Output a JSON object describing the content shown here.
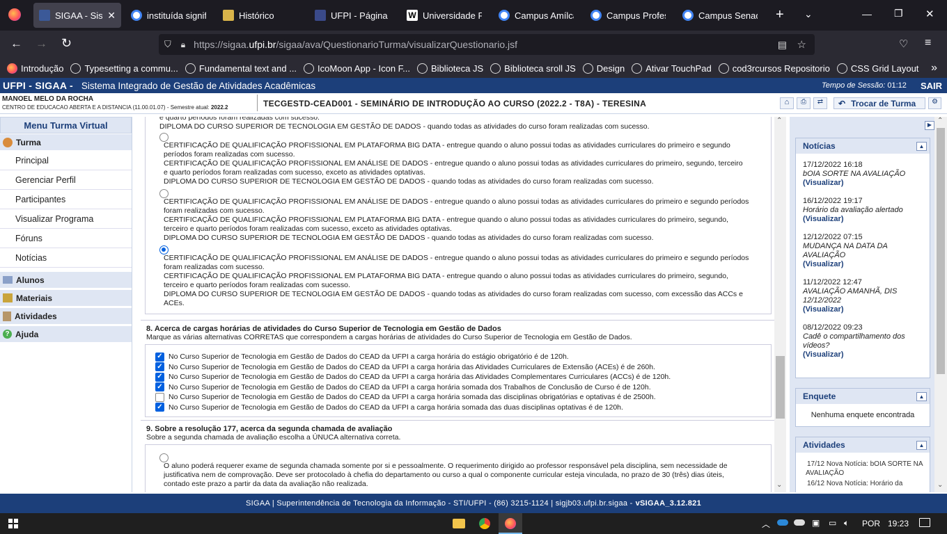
{
  "browser": {
    "tabs": [
      {
        "title": "SIGAA - Sistema",
        "active": true
      },
      {
        "title": "instituída signific"
      },
      {
        "title": "Histórico"
      },
      {
        "title": "UFPI - Página ini"
      },
      {
        "title": "Universidade Fed"
      },
      {
        "title": "Campus Amílcar"
      },
      {
        "title": "Campus Professo"
      },
      {
        "title": "Campus Senador"
      }
    ],
    "url_prefix": "https://sigaa.",
    "url_domain": "ufpi.br",
    "url_path": "/sigaa/ava/QuestionarioTurma/visualizarQuestionario.jsf",
    "bookmarks": [
      "Introdução",
      "Typesetting a commu...",
      "Fundamental text and ...",
      "IcoMoon App - Icon F...",
      "Biblioteca JS",
      "Biblioteca sroll JS",
      "Design",
      "Ativar TouchPad",
      "cod3rcursos Repositorio",
      "CSS Grid Layout"
    ]
  },
  "header": {
    "brand": "UFPI - SIGAA -",
    "system_name": "Sistema Integrado de Gestão de Atividades Acadêmicas",
    "session_label": "Tempo de Sessão:",
    "session_time": "01:12",
    "exit": "SAIR"
  },
  "user": {
    "name": "MANOEL MELO DA ROCHA",
    "center": "CENTRO DE EDUCACAO ABERTA E A DISTANCIA (11.00.01.07) - Semestre atual:",
    "semester": "2022.2"
  },
  "course_title": "TECGESTD-CEAD001 - SEMINÁRIO DE INTRODUÇÃO AO CURSO (2022.2 - T8A) - TERESINA",
  "switch_class": "Trocar de Turma",
  "menu": {
    "title": "Menu Turma Virtual",
    "turma": "Turma",
    "items": [
      "Principal",
      "Gerenciar Perfil",
      "Participantes",
      "Visualizar Programa",
      "Fóruns",
      "Notícias"
    ],
    "sections": [
      "Alunos",
      "Materiais",
      "Atividades",
      "Ajuda"
    ]
  },
  "q7": {
    "top_lines": [
      "e quarto períodos foram realizadas com sucesso.",
      "DIPLOMA DO CURSO SUPERIOR DE TECNOLOGIA EM GESTÃO DE DADOS - quando todas as atividades do curso foram realizadas com sucesso."
    ],
    "options": [
      {
        "selected": false,
        "lines": [
          "CERTIFICAÇÃO DE QUALIFICAÇÃO PROFISSIONAL EM PLATAFORMA BIG DATA - entregue quando o aluno possui todas as atividades curriculares do primeiro e segundo",
          "períodos foram realizadas com sucesso.",
          "CERTIFICAÇÃO DE QUALIFICAÇÃO PROFISSIONAL EM ANÁLISE DE DADOS  - entregue quando o aluno possui todas as atividades curriculares do primeiro, segundo, terceiro",
          "e quarto períodos foram realizadas com sucesso, exceto as atividades optativas.",
          "DIPLOMA DO CURSO SUPERIOR DE TECNOLOGIA EM GESTÃO DE DADOS - quando todas as atividades do curso foram realizadas com sucesso."
        ]
      },
      {
        "selected": false,
        "lines": [
          "CERTIFICAÇÃO DE QUALIFICAÇÃO PROFISSIONAL EM ANÁLISE DE DADOS - entregue quando o aluno possui todas as atividades curriculares do primeiro e segundo períodos",
          "foram realizadas com sucesso.",
          "CERTIFICAÇÃO DE QUALIFICAÇÃO PROFISSIONAL EM PLATAFORMA BIG DATA  - entregue quando o aluno possui todas as atividades curriculares do primeiro, segundo,",
          "terceiro e quarto períodos foram realizadas com sucesso, exceto as atividades optativas.",
          "DIPLOMA DO CURSO SUPERIOR DE TECNOLOGIA EM GESTÃO DE DADOS - quando todas as atividades do curso foram realizadas com sucesso."
        ]
      },
      {
        "selected": true,
        "lines": [
          "CERTIFICAÇÃO DE QUALIFICAÇÃO PROFISSIONAL EM ANÁLISE DE DADOS - entregue quando o aluno possui todas as atividades curriculares do primeiro e segundo períodos",
          "foram realizadas com sucesso.",
          "CERTIFICAÇÃO DE QUALIFICAÇÃO PROFISSIONAL EM PLATAFORMA BIG DATA  - entregue quando o aluno possui todas as atividades curriculares do primeiro, segundo,",
          "terceiro e quarto períodos foram realizadas com sucesso.",
          "DIPLOMA DO CURSO SUPERIOR DE TECNOLOGIA EM GESTÃO DE DADOS - quando todas as atividades do curso foram realizadas com sucesso, com excessão das ACCs e",
          "ACEs."
        ]
      }
    ]
  },
  "q8": {
    "title": "8. Acerca de cargas horárias de atividades do Curso Superior de Tecnologia em Gestão de Dados",
    "subtitle": "Marque as várias alternativas CORRETAS que correspondem a cargas horárias de atividades do Curso Superior de Tecnologia em Gestão de Dados.",
    "options": [
      {
        "checked": true,
        "text": "No Curso Superior de Tecnologia em Gestão de Dados do CEAD da UFPI a carga horária do estágio obrigatório é de 120h."
      },
      {
        "checked": true,
        "text": "No Curso Superior de Tecnologia em Gestão de Dados do CEAD da UFPI a carga horária das Atividades Curriculares de Extensão (ACEs) é de 260h."
      },
      {
        "checked": true,
        "text": "No Curso Superior de Tecnologia em Gestão de Dados do CEAD da UFPI a carga horária das Atividades Complementares Curriculares (ACCs) é de 120h."
      },
      {
        "checked": true,
        "text": "No Curso Superior de Tecnologia em Gestão de Dados do CEAD da UFPI a carga horária somada dos Trabalhos de Conclusão de Curso é de 120h."
      },
      {
        "checked": false,
        "text": "No Curso Superior de Tecnologia em Gestão de Dados do CEAD da UFPI a carga horária somada das disciplinas obrigatórias e optativas é de 2500h."
      },
      {
        "checked": true,
        "text": "No Curso Superior de Tecnologia em Gestão de Dados do CEAD da UFPI a carga horária somada das duas disciplinas optativas é de 120h."
      }
    ]
  },
  "q9": {
    "title": "9. Sobre a resolução 177, acerca da segunda chamada de avaliação",
    "subtitle": "Sobre a segunda chamada de avaliação escolha a ÚNUCA alternativa correta.",
    "option_lines": [
      "O aluno poderá requerer exame de segunda chamada somente por si e pessoalmente. O requerimento dirigido ao professor responsável pela disciplina, sem necessidade de",
      "justificativa nem de comprovação. Deve ser protocolado à chefia do departamento ou curso a qual o componente curricular esteja vinculada, no prazo de 30 (três) dias úteis,",
      "contado este prazo a partir da data da avaliação não realizada."
    ]
  },
  "news": {
    "title": "Notícias",
    "link": "(Visualizar)",
    "items": [
      {
        "date": "17/12/2022 16:18",
        "msg": "bOIA SORTE NA AVALIAÇÃO"
      },
      {
        "date": "16/12/2022 19:17",
        "msg": "Horário da avaliação alertado"
      },
      {
        "date": "12/12/2022 07:15",
        "msg": "MUDANÇA NA DATA DA AVALIAÇÃO"
      },
      {
        "date": "11/12/2022 12:47",
        "msg": "AVALIAÇÃO AMANHÃ, DIS 12/12/2022"
      },
      {
        "date": "08/12/2022 09:23",
        "msg": "Cadê o compartilhamento dos vídeos?"
      }
    ]
  },
  "poll": {
    "title": "Enquete",
    "empty": "Nenhuma enquete encontrada"
  },
  "activities": {
    "title": "Atividades",
    "items": [
      {
        "date": "17/12",
        "text": "Nova Notícia: bOIA SORTE NA AVALIAÇÃO"
      },
      {
        "date": "16/12",
        "text": "Nova Notícia: Horário da"
      }
    ]
  },
  "footer": {
    "text": "SIGAA | Superintendência de Tecnologia da Informação - STI/UFPI - (86) 3215-1124 | sigjb03.ufpi.br.sigaa - ",
    "version": "vSIGAA_3.12.821"
  },
  "taskbar": {
    "lang": "POR",
    "time": "19:23"
  },
  "colors": {
    "sigaa_blue": "#1c3f7a",
    "panel_bg": "#dfe6f3",
    "check_blue": "#0060df"
  }
}
